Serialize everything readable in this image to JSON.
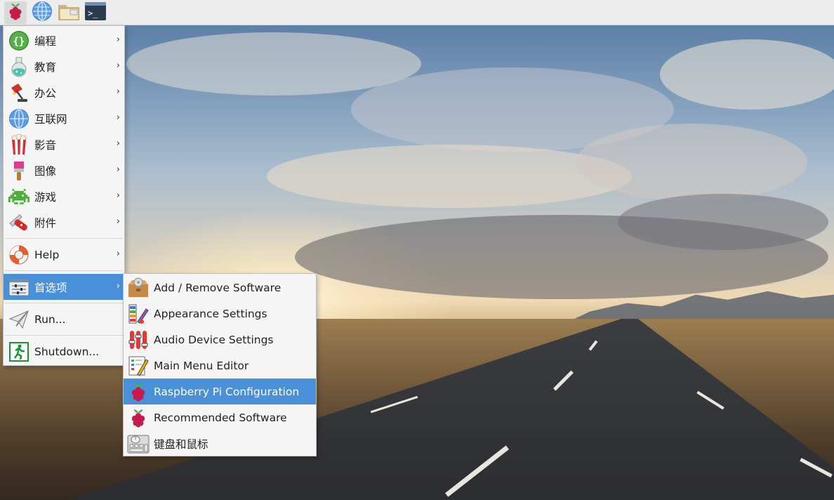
{
  "panel": {
    "buttons": [
      {
        "name": "raspberry-menu-button",
        "icon": "raspberry-icon"
      },
      {
        "name": "web-browser-button",
        "icon": "globe-icon"
      },
      {
        "name": "file-manager-button",
        "icon": "folder-icon"
      },
      {
        "name": "terminal-button",
        "icon": "terminal-icon",
        "text": ">_"
      }
    ]
  },
  "main_menu": {
    "items": [
      {
        "label": "编程",
        "icon": "programming-braces-icon"
      },
      {
        "label": "教育",
        "icon": "education-flask-icon"
      },
      {
        "label": "办公",
        "icon": "office-lamp-icon"
      },
      {
        "label": "互联网",
        "icon": "globe-icon"
      },
      {
        "label": "影音",
        "icon": "popcorn-icon"
      },
      {
        "label": "图像",
        "icon": "paintbrush-icon"
      },
      {
        "label": "游戏",
        "icon": "space-invader-icon"
      },
      {
        "label": "附件",
        "icon": "swiss-knife-icon"
      },
      {
        "label": "Help",
        "icon": "lifebuoy-icon"
      },
      {
        "label": "首选项",
        "icon": "preferences-icon"
      },
      {
        "label": "Run...",
        "icon": "paper-plane-icon"
      },
      {
        "label": "Shutdown...",
        "icon": "exit-running-man-icon"
      }
    ],
    "submenu_indicator": "›"
  },
  "preferences_submenu": {
    "items": [
      {
        "label": "Add / Remove Software",
        "icon": "package-box-icon"
      },
      {
        "label": "Appearance Settings",
        "icon": "appearance-palette-icon"
      },
      {
        "label": "Audio Device Settings",
        "icon": "audio-sliders-icon"
      },
      {
        "label": "Main Menu Editor",
        "icon": "menu-editor-pencil-icon"
      },
      {
        "label": "Raspberry Pi Configuration",
        "icon": "raspberry-icon"
      },
      {
        "label": "Recommended Software",
        "icon": "raspberry-icon"
      },
      {
        "label": "键盘和鼠标",
        "icon": "keyboard-mouse-icon"
      }
    ],
    "highlighted_index": 4
  },
  "colors": {
    "highlight": "#4a90d9",
    "menu_background": "#f5f5f5",
    "panel_background": "#ededed"
  }
}
